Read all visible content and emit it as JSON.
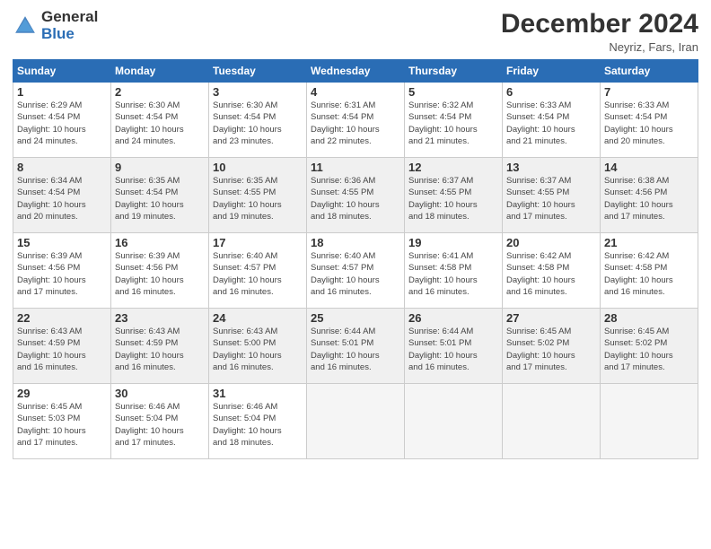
{
  "logo": {
    "general": "General",
    "blue": "Blue"
  },
  "header": {
    "title": "December 2024",
    "subtitle": "Neyriz, Fars, Iran"
  },
  "weekdays": [
    "Sunday",
    "Monday",
    "Tuesday",
    "Wednesday",
    "Thursday",
    "Friday",
    "Saturday"
  ],
  "weeks": [
    [
      {
        "day": "1",
        "info": "Sunrise: 6:29 AM\nSunset: 4:54 PM\nDaylight: 10 hours\nand 24 minutes.",
        "shaded": false
      },
      {
        "day": "2",
        "info": "Sunrise: 6:30 AM\nSunset: 4:54 PM\nDaylight: 10 hours\nand 24 minutes.",
        "shaded": false
      },
      {
        "day": "3",
        "info": "Sunrise: 6:30 AM\nSunset: 4:54 PM\nDaylight: 10 hours\nand 23 minutes.",
        "shaded": false
      },
      {
        "day": "4",
        "info": "Sunrise: 6:31 AM\nSunset: 4:54 PM\nDaylight: 10 hours\nand 22 minutes.",
        "shaded": false
      },
      {
        "day": "5",
        "info": "Sunrise: 6:32 AM\nSunset: 4:54 PM\nDaylight: 10 hours\nand 21 minutes.",
        "shaded": false
      },
      {
        "day": "6",
        "info": "Sunrise: 6:33 AM\nSunset: 4:54 PM\nDaylight: 10 hours\nand 21 minutes.",
        "shaded": false
      },
      {
        "day": "7",
        "info": "Sunrise: 6:33 AM\nSunset: 4:54 PM\nDaylight: 10 hours\nand 20 minutes.",
        "shaded": false
      }
    ],
    [
      {
        "day": "8",
        "info": "Sunrise: 6:34 AM\nSunset: 4:54 PM\nDaylight: 10 hours\nand 20 minutes.",
        "shaded": true
      },
      {
        "day": "9",
        "info": "Sunrise: 6:35 AM\nSunset: 4:54 PM\nDaylight: 10 hours\nand 19 minutes.",
        "shaded": true
      },
      {
        "day": "10",
        "info": "Sunrise: 6:35 AM\nSunset: 4:55 PM\nDaylight: 10 hours\nand 19 minutes.",
        "shaded": true
      },
      {
        "day": "11",
        "info": "Sunrise: 6:36 AM\nSunset: 4:55 PM\nDaylight: 10 hours\nand 18 minutes.",
        "shaded": true
      },
      {
        "day": "12",
        "info": "Sunrise: 6:37 AM\nSunset: 4:55 PM\nDaylight: 10 hours\nand 18 minutes.",
        "shaded": true
      },
      {
        "day": "13",
        "info": "Sunrise: 6:37 AM\nSunset: 4:55 PM\nDaylight: 10 hours\nand 17 minutes.",
        "shaded": true
      },
      {
        "day": "14",
        "info": "Sunrise: 6:38 AM\nSunset: 4:56 PM\nDaylight: 10 hours\nand 17 minutes.",
        "shaded": true
      }
    ],
    [
      {
        "day": "15",
        "info": "Sunrise: 6:39 AM\nSunset: 4:56 PM\nDaylight: 10 hours\nand 17 minutes.",
        "shaded": false
      },
      {
        "day": "16",
        "info": "Sunrise: 6:39 AM\nSunset: 4:56 PM\nDaylight: 10 hours\nand 16 minutes.",
        "shaded": false
      },
      {
        "day": "17",
        "info": "Sunrise: 6:40 AM\nSunset: 4:57 PM\nDaylight: 10 hours\nand 16 minutes.",
        "shaded": false
      },
      {
        "day": "18",
        "info": "Sunrise: 6:40 AM\nSunset: 4:57 PM\nDaylight: 10 hours\nand 16 minutes.",
        "shaded": false
      },
      {
        "day": "19",
        "info": "Sunrise: 6:41 AM\nSunset: 4:58 PM\nDaylight: 10 hours\nand 16 minutes.",
        "shaded": false
      },
      {
        "day": "20",
        "info": "Sunrise: 6:42 AM\nSunset: 4:58 PM\nDaylight: 10 hours\nand 16 minutes.",
        "shaded": false
      },
      {
        "day": "21",
        "info": "Sunrise: 6:42 AM\nSunset: 4:58 PM\nDaylight: 10 hours\nand 16 minutes.",
        "shaded": false
      }
    ],
    [
      {
        "day": "22",
        "info": "Sunrise: 6:43 AM\nSunset: 4:59 PM\nDaylight: 10 hours\nand 16 minutes.",
        "shaded": true
      },
      {
        "day": "23",
        "info": "Sunrise: 6:43 AM\nSunset: 4:59 PM\nDaylight: 10 hours\nand 16 minutes.",
        "shaded": true
      },
      {
        "day": "24",
        "info": "Sunrise: 6:43 AM\nSunset: 5:00 PM\nDaylight: 10 hours\nand 16 minutes.",
        "shaded": true
      },
      {
        "day": "25",
        "info": "Sunrise: 6:44 AM\nSunset: 5:01 PM\nDaylight: 10 hours\nand 16 minutes.",
        "shaded": true
      },
      {
        "day": "26",
        "info": "Sunrise: 6:44 AM\nSunset: 5:01 PM\nDaylight: 10 hours\nand 16 minutes.",
        "shaded": true
      },
      {
        "day": "27",
        "info": "Sunrise: 6:45 AM\nSunset: 5:02 PM\nDaylight: 10 hours\nand 17 minutes.",
        "shaded": true
      },
      {
        "day": "28",
        "info": "Sunrise: 6:45 AM\nSunset: 5:02 PM\nDaylight: 10 hours\nand 17 minutes.",
        "shaded": true
      }
    ],
    [
      {
        "day": "29",
        "info": "Sunrise: 6:45 AM\nSunset: 5:03 PM\nDaylight: 10 hours\nand 17 minutes.",
        "shaded": false
      },
      {
        "day": "30",
        "info": "Sunrise: 6:46 AM\nSunset: 5:04 PM\nDaylight: 10 hours\nand 17 minutes.",
        "shaded": false
      },
      {
        "day": "31",
        "info": "Sunrise: 6:46 AM\nSunset: 5:04 PM\nDaylight: 10 hours\nand 18 minutes.",
        "shaded": false
      },
      null,
      null,
      null,
      null
    ]
  ]
}
